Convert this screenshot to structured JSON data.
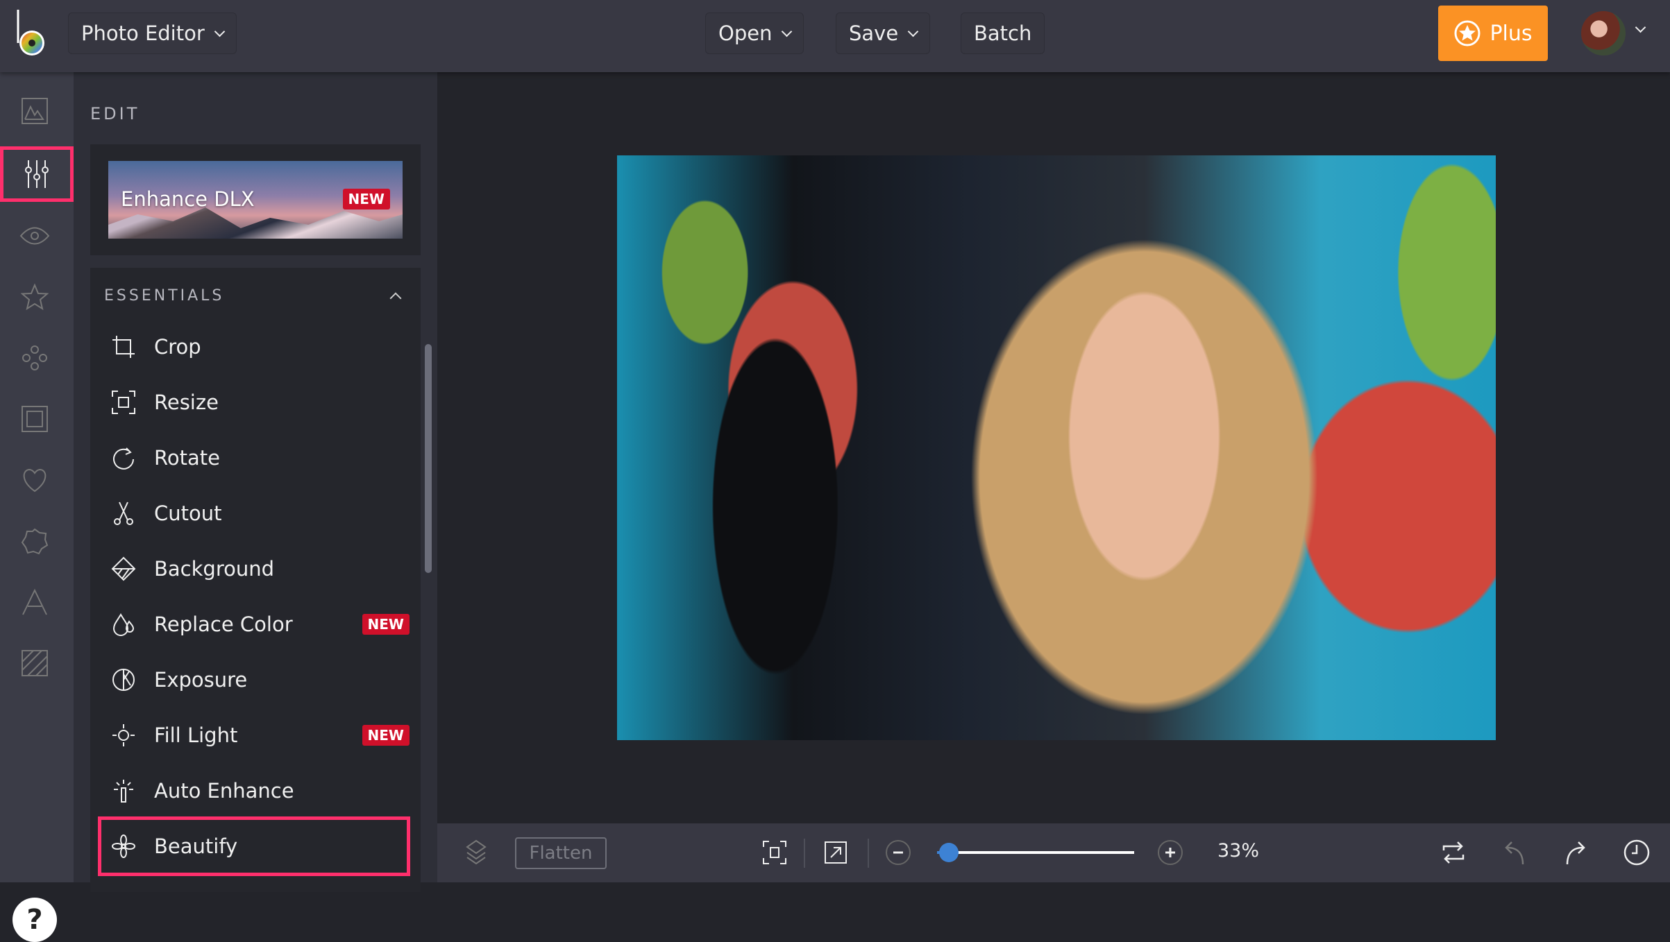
{
  "app": {
    "menu_label": "Photo Editor"
  },
  "toolbar": {
    "open_label": "Open",
    "save_label": "Save",
    "batch_label": "Batch",
    "plus_label": "Plus"
  },
  "colors": {
    "accent_orange": "#fb9224",
    "highlight": "#ff2f6c",
    "new_badge": "#d0102a",
    "slider": "#3d82d4"
  },
  "rail": {
    "items": [
      {
        "icon": "image-icon"
      },
      {
        "icon": "sliders-icon",
        "selected": true
      },
      {
        "icon": "eye-icon"
      },
      {
        "icon": "star-icon"
      },
      {
        "icon": "effects-icon"
      },
      {
        "icon": "frame-icon"
      },
      {
        "icon": "heart-icon"
      },
      {
        "icon": "badge-icon"
      },
      {
        "icon": "text-icon"
      },
      {
        "icon": "texture-icon"
      }
    ],
    "help_label": "?"
  },
  "panel": {
    "section_label": "EDIT",
    "promo": {
      "title": "Enhance DLX",
      "badge": "NEW"
    },
    "essentials": {
      "header": "ESSENTIALS",
      "items": [
        {
          "label": "Crop",
          "icon": "crop-icon"
        },
        {
          "label": "Resize",
          "icon": "resize-icon"
        },
        {
          "label": "Rotate",
          "icon": "rotate-icon"
        },
        {
          "label": "Cutout",
          "icon": "scissors-icon"
        },
        {
          "label": "Background",
          "icon": "background-icon"
        },
        {
          "label": "Replace Color",
          "icon": "drops-icon",
          "badge": "NEW"
        },
        {
          "label": "Exposure",
          "icon": "exposure-icon"
        },
        {
          "label": "Fill Light",
          "icon": "fill-light-icon",
          "badge": "NEW"
        },
        {
          "label": "Auto Enhance",
          "icon": "magic-wand-icon"
        },
        {
          "label": "Beautify",
          "icon": "beautify-icon",
          "selected": true
        }
      ]
    }
  },
  "bottom": {
    "flatten_label": "Flatten",
    "zoom_text": "33%",
    "zoom_percent": 33,
    "slider_fraction": 0.06
  }
}
